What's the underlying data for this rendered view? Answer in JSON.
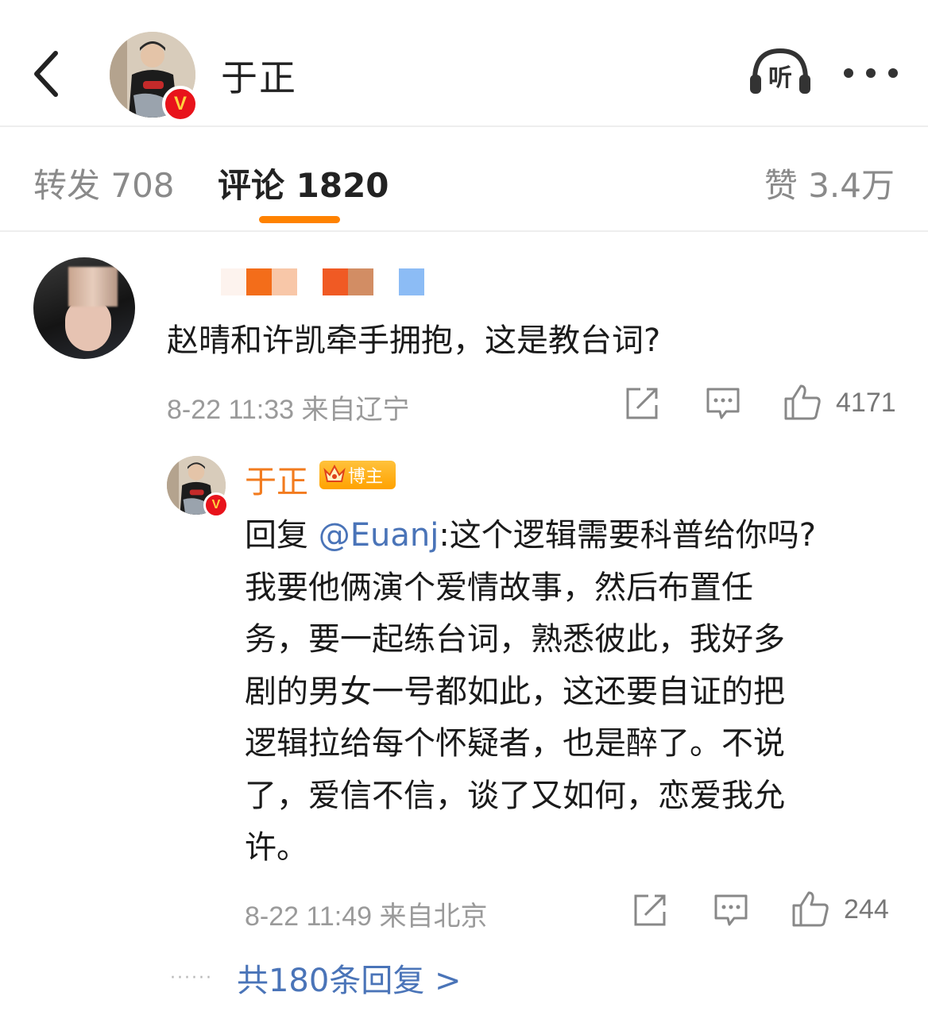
{
  "header": {
    "title": "于正",
    "listen_label": "听",
    "verified_mark": "V"
  },
  "tabs": {
    "repost": "转发 708",
    "comments": "评论 1820",
    "likes": "赞 3.4万",
    "active_color": "#ff8200"
  },
  "comment": {
    "text": "赵晴和许凯牵手拥抱，这是教台词?",
    "meta": "8-22 11:33 来自辽宁",
    "like_count": "4171"
  },
  "reply": {
    "name": "于正",
    "badge": "博主",
    "reply_prefix": "回复 ",
    "mention": "@Euanj",
    "lines": [
      ":这个逻辑需要科普给你吗?",
      "我要他俩演个爱情故事，然后布置任",
      "务，要一起练台词，熟悉彼此，我好多",
      "剧的男女一号都如此，这还要自证的把",
      "逻辑拉给每个怀疑者，也是醉了。不说",
      "了，爱信不信，谈了又如何，恋爱我允",
      "许。"
    ],
    "meta": "8-22 11:49 来自北京",
    "like_count": "244",
    "name_color": "#f27b1e",
    "mention_color": "#4a74b8"
  },
  "more_replies": {
    "dots": "······",
    "label": "共180条回复 >"
  },
  "icons": [
    "back-arrow-icon",
    "listen-headphones-icon",
    "more-dots-icon",
    "share-icon",
    "comment-icon",
    "thumbs-up-icon",
    "crown-icon"
  ]
}
